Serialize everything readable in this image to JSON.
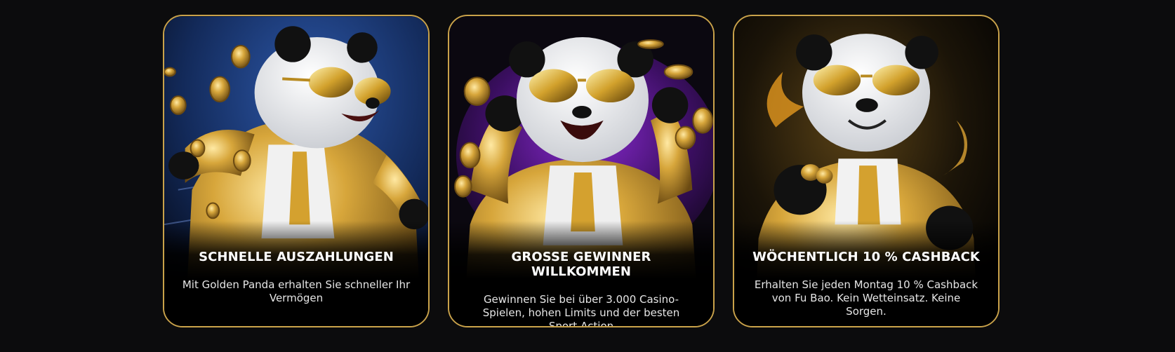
{
  "features": {
    "cards": [
      {
        "title": "SCHNELLE AUSZAHLUNGEN",
        "description": "Mit Golden Panda erhalten Sie schneller Ihr Vermögen",
        "background": "#1a3a78"
      },
      {
        "title": "GROSSE GEWINNER WILLKOMMEN",
        "description": "Gewinnen Sie bei über 3.000 Casino-Spielen, hohen Limits und der besten Sport-Action",
        "background": "#5b1e8c"
      },
      {
        "title": "WÖCHENTLICH 10 % CASHBACK",
        "description": "Erhalten Sie jeden Montag 10 % Cashback von Fu Bao. Kein Wetteinsatz. Keine Sorgen.",
        "background": "#2a1f0a"
      }
    ],
    "border_color": "#c9a24a"
  },
  "next_section_heading": ""
}
